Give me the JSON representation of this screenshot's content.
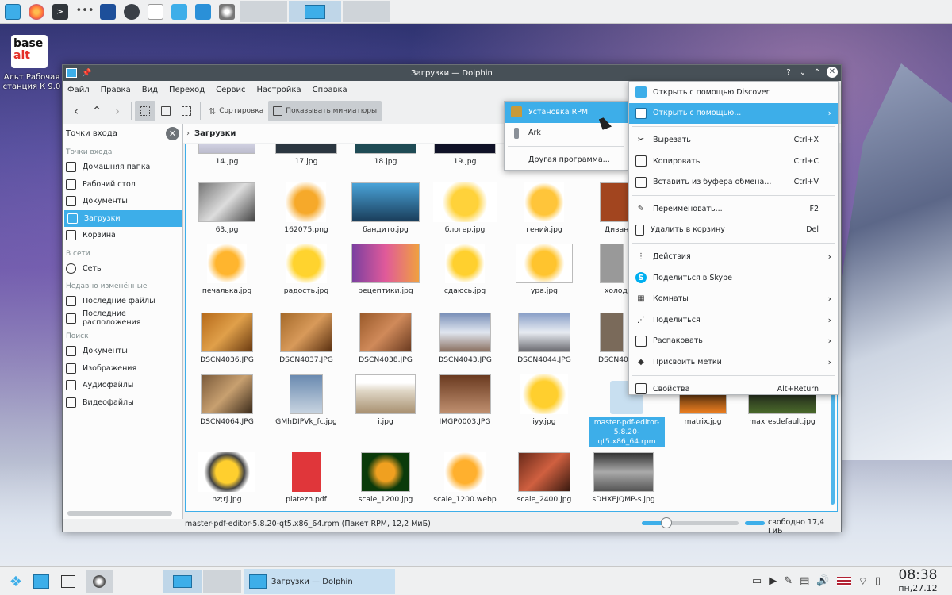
{
  "colors": {
    "accent": "#3daee9",
    "titlebar": "#475057",
    "panel": "#eff0f1"
  },
  "desktop": {
    "logo_line1": "base",
    "logo_line2": "alt",
    "label": "Альт Рабочая станция К 9.0"
  },
  "window": {
    "title": "Загрузки — Dolphin",
    "title_buttons": [
      "?",
      "⌄",
      "⌃",
      "✕"
    ]
  },
  "menubar": [
    "Файл",
    "Правка",
    "Вид",
    "Переход",
    "Сервис",
    "Настройка",
    "Справка"
  ],
  "toolbar": {
    "sort_label": "Сортировка",
    "preview_label": "Показывать миниатюры"
  },
  "sidebar": {
    "header": "Точки входа",
    "groups": [
      {
        "title": "Точки входа",
        "items": [
          "Домашняя папка",
          "Рабочий стол",
          "Документы",
          "Загрузки",
          "Корзина"
        ]
      },
      {
        "title": "В сети",
        "items": [
          "Сеть"
        ]
      },
      {
        "title": "Недавно изменённые",
        "items": [
          "Последние файлы",
          "Последние расположения"
        ]
      },
      {
        "title": "Поиск",
        "items": [
          "Документы",
          "Изображения",
          "Аудиофайлы",
          "Видеофайлы"
        ]
      }
    ],
    "selected": "Загрузки"
  },
  "breadcrumb": "Загрузки",
  "files": [
    "14.jpg",
    "17.jpg",
    "18.jpg",
    "19.jpg",
    "63.jpg",
    "162075.png",
    "бандито.jpg",
    "блогер.jpg",
    "гений.jpg",
    "Диван",
    "печалька.jpg",
    "радость.jpg",
    "рецептики.jpg",
    "сдаюсь.jpg",
    "ура.jpg",
    "холод",
    "DSCN4036.JPG",
    "DSCN4037.JPG",
    "DSCN4038.JPG",
    "DSCN4043.JPG",
    "DSCN4044.JPG",
    "DSCN40",
    "DSCN4064.JPG",
    "GMhDIPVk_fc.jpg",
    "i.jpg",
    "IMGP0003.JPG",
    "iyy.jpg",
    "master-pdf-editor-5.8.20-qt5.x86_64.rpm",
    "matrix.jpg",
    "maxresdefault.jpg",
    "nz;rj.jpg",
    "platezh.pdf",
    "scale_1200.jpg",
    "scale_1200.webp",
    "scale_2400.jpg",
    "sDHXEJQMP-s.jpg"
  ],
  "selected_file": "master-pdf-editor-5.8.20-qt5.x86_64.rpm",
  "statusbar": {
    "text": "master-pdf-editor-5.8.20-qt5.x86_64.rpm (Пакет RPM, 12,2 МиБ)",
    "free_space": "свободно 17,4 ГиБ",
    "zoom_fraction": 0.25
  },
  "context_menu": {
    "items": [
      {
        "label": "Открыть с помощью Discover",
        "shortcut": "",
        "submenu": false,
        "icon": "discover-icon"
      },
      {
        "label": "Открыть с помощью...",
        "shortcut": "",
        "submenu": true,
        "icon": "open-with-icon",
        "highlight": true
      },
      {
        "sep": true
      },
      {
        "label": "Вырезать",
        "shortcut": "Ctrl+X",
        "icon": "cut-icon"
      },
      {
        "label": "Копировать",
        "shortcut": "Ctrl+C",
        "icon": "copy-icon"
      },
      {
        "label": "Вставить из буфера обмена...",
        "shortcut": "Ctrl+V",
        "icon": "paste-icon"
      },
      {
        "sep": true
      },
      {
        "label": "Переименовать...",
        "shortcut": "F2",
        "icon": "rename-icon"
      },
      {
        "label": "Удалить в корзину",
        "shortcut": "Del",
        "icon": "trash-icon"
      },
      {
        "sep": true
      },
      {
        "label": "Действия",
        "submenu": true,
        "icon": "actions-icon"
      },
      {
        "label": "Поделиться в Skype",
        "icon": "skype-icon"
      },
      {
        "label": "Комнаты",
        "submenu": true,
        "icon": "activities-icon"
      },
      {
        "label": "Поделиться",
        "submenu": true,
        "icon": "share-icon"
      },
      {
        "label": "Распаковать",
        "submenu": true,
        "icon": "extract-icon"
      },
      {
        "label": "Присвоить метки",
        "submenu": true,
        "icon": "tag-icon"
      },
      {
        "sep": true
      },
      {
        "label": "Свойства",
        "shortcut": "Alt+Return",
        "icon": "properties-icon"
      }
    ]
  },
  "submenu": {
    "items": [
      {
        "label": "Установка RPM",
        "highlight": true
      },
      {
        "label": "Ark"
      },
      {
        "sep": true
      },
      {
        "label": "Другая программа..."
      }
    ]
  },
  "taskbar": {
    "task_title": "Загрузки — Dolphin",
    "time": "08:38",
    "date": "пн,27.12"
  }
}
